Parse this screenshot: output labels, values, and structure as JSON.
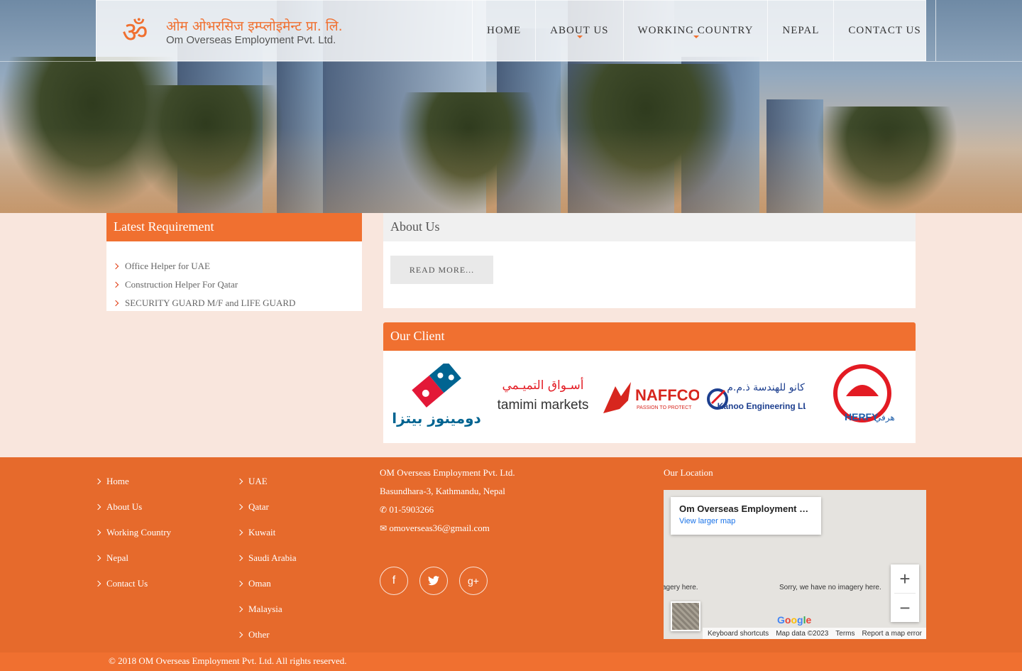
{
  "logo": {
    "hindi": "ओम ओभरसिज इम्प्लोइमेन्ट प्रा. लि.",
    "english": "Om Overseas Employment Pvt. Ltd."
  },
  "nav": {
    "items": [
      {
        "label": "Home",
        "dropdown": false
      },
      {
        "label": "About Us",
        "dropdown": true
      },
      {
        "label": "Working Country",
        "dropdown": true
      },
      {
        "label": "Nepal",
        "dropdown": false
      },
      {
        "label": "Contact Us",
        "dropdown": false
      }
    ]
  },
  "latest_requirement": {
    "title": "Latest Requirement",
    "items": [
      "Office Helper for UAE",
      "Construction Helper For Qatar",
      "SECURITY GUARD M/F and LIFE GUARD"
    ]
  },
  "about": {
    "title": "About Us",
    "read_more": "Read More..."
  },
  "clients": {
    "title": "Our Client",
    "logos": [
      {
        "name": "Domino's Pizza",
        "arabic": "دومينوز بيتزا"
      },
      {
        "name": "tamimi markets",
        "arabic": "أسـواق التميـمي"
      },
      {
        "name": "NAFFCO",
        "tagline": "PASSION TO PROTECT"
      },
      {
        "name": "Kanoo Engineering LLC",
        "arabic": "كانو للهندسة ذ.م.م"
      },
      {
        "name": "HERFY",
        "arabic": "هرفي"
      }
    ]
  },
  "footer": {
    "links_col1": [
      "Home",
      "About Us",
      "Working Country",
      "Nepal",
      "Contact Us"
    ],
    "links_col2": [
      "UAE",
      "Qatar",
      "Kuwait",
      "Saudi Arabia",
      "Oman",
      "Malaysia",
      "Other"
    ],
    "company": "OM Overseas Employment Pvt. Ltd.",
    "address": "Basundhara-3, Kathmandu, Nepal",
    "phone": "01-5903266",
    "email": "omoverseas36@gmail.com",
    "location_title": "Our Location",
    "copyright": "© 2018 OM Overseas Employment Pvt. Ltd. All rights reserved."
  },
  "map": {
    "place_name": "Om Overseas Employment Pvt. Ltd.",
    "view_larger": "View larger map",
    "no_imagery": "Sorry, we have no imagery here.",
    "no_imagery_cut": "agery here.",
    "keyboard": "Keyboard shortcuts",
    "map_data": "Map data ©2023",
    "terms": "Terms",
    "report": "Report a map error"
  },
  "colors": {
    "accent": "#f07030",
    "footer_bg": "#e66a2c",
    "page_bg": "#f9e6dd"
  }
}
